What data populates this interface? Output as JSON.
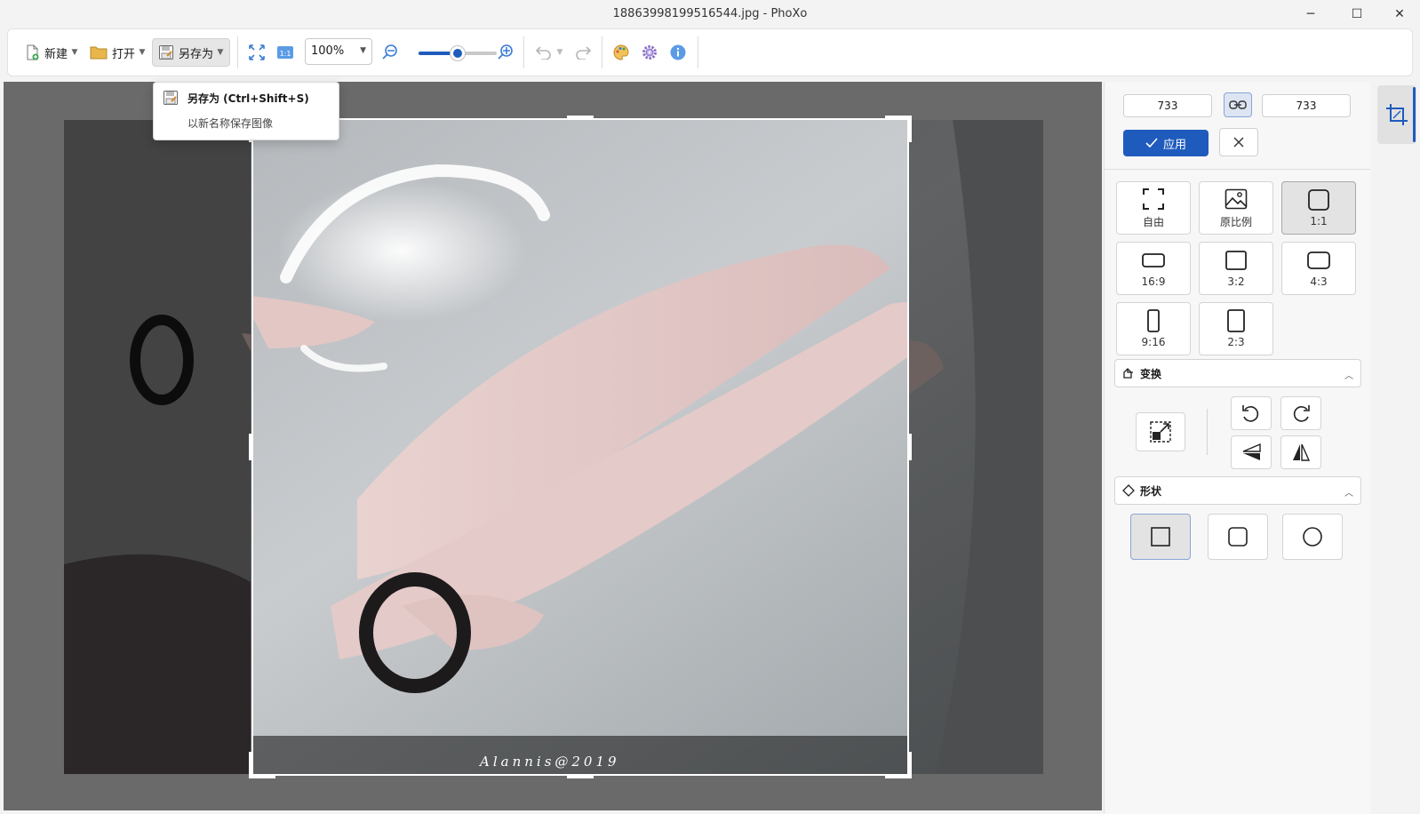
{
  "window": {
    "title": "18863998199516544.jpg - PhoXo",
    "minimize": "─",
    "maximize": "☐",
    "close": "✕"
  },
  "toolbar": {
    "new_label": "新建",
    "open_label": "打开",
    "save_as_label": "另存为",
    "zoom_value": "100%",
    "zoom_slider_fraction": 0.5
  },
  "tooltip": {
    "title": "另存为 (Ctrl+Shift+S)",
    "description": "以新名称保存图像"
  },
  "crop": {
    "width_value": "733",
    "height_value": "733",
    "apply_label": "应用",
    "ratios": [
      {
        "key": "free",
        "label": "自由"
      },
      {
        "key": "original",
        "label": "原比例"
      },
      {
        "key": "1-1",
        "label": "1:1"
      },
      {
        "key": "16-9",
        "label": "16:9"
      },
      {
        "key": "3-2",
        "label": "3:2"
      },
      {
        "key": "4-3",
        "label": "4:3"
      },
      {
        "key": "9-16",
        "label": "9:16"
      },
      {
        "key": "2-3",
        "label": "2:3"
      }
    ],
    "selected_ratio": "1:1"
  },
  "transform_section": {
    "title": "变换"
  },
  "shape_section": {
    "title": "形状"
  },
  "image": {
    "watermark": "Alannis@2019"
  },
  "colors": {
    "accent": "#1e5bbd",
    "canvas_bg": "#6a6a6a"
  }
}
